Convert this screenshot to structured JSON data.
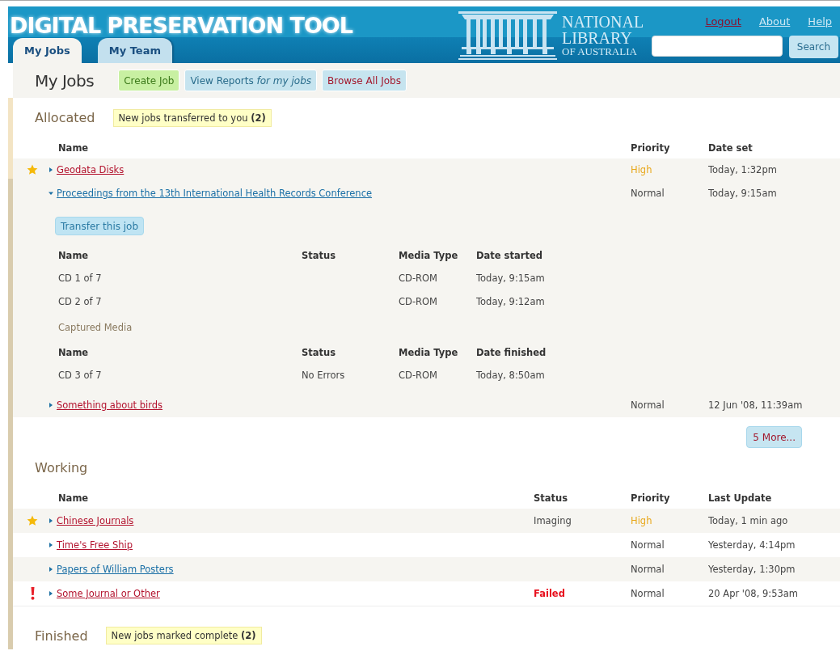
{
  "header": {
    "title": "DIGITAL PRESERVATION TOOL",
    "tabs": [
      {
        "label": "My Jobs",
        "selected": true
      },
      {
        "label": "My Team",
        "selected": false
      }
    ],
    "logo_lines": [
      "NATIONAL",
      "LIBRARY",
      "OF AUSTRALIA"
    ],
    "links": [
      {
        "label": "Logout",
        "kind": "logout"
      },
      {
        "label": "About",
        "kind": "plain"
      },
      {
        "label": "Help",
        "kind": "plain"
      }
    ],
    "search_button": "Search"
  },
  "toolbar": {
    "heading": "My Jobs",
    "buttons": [
      {
        "label": "Create Job",
        "kind": "create"
      },
      {
        "label": "View Reports *for my jobs*",
        "kind": "reports"
      },
      {
        "label": "Browse All Jobs",
        "kind": "browse"
      }
    ]
  },
  "sections": [
    {
      "title": "Allocated",
      "notice": "New jobs transferred to you **(2)**",
      "columns": [
        "Name",
        "Priority",
        "Date set"
      ],
      "rows": [
        {
          "starred": true,
          "alert": false,
          "name": "Geodata Disks",
          "visited": false,
          "expanded": false,
          "priority": "High",
          "high_priority": true,
          "date": "Today, 1:32pm"
        },
        {
          "starred": false,
          "alert": false,
          "name": "Proceedings from the 13th International Health Records Conference",
          "visited": true,
          "expanded": true,
          "priority": "Normal",
          "high_priority": false,
          "date": "Today, 9:15am",
          "detail": {
            "button": "Transfer this job",
            "tables": [
              {
                "columns": [
                  "Name",
                  "Status",
                  "Media Type",
                  "Date started"
                ],
                "rows": [
                  [
                    "CD 1 of 7",
                    "",
                    "CD-ROM",
                    "Today, 9:15am"
                  ],
                  [
                    "CD 2 of 7",
                    "",
                    "CD-ROM",
                    "Today, 9:12am"
                  ]
                ]
              },
              {
                "title": "Captured Media",
                "columns": [
                  "Name",
                  "Status",
                  "Media Type",
                  "Date finished"
                ],
                "rows": [
                  [
                    "CD 3 of 7",
                    "No Errors",
                    "CD-ROM",
                    "Today, 8:50am"
                  ]
                ]
              }
            ]
          }
        },
        {
          "starred": false,
          "alert": false,
          "name": "Something about birds",
          "visited": false,
          "expanded": false,
          "priority": "Normal",
          "high_priority": false,
          "date": "12 Jun '08, 11:39am"
        }
      ],
      "more_button": "5 More..."
    },
    {
      "title": "Working",
      "columns": [
        "Name",
        "Status",
        "Priority",
        "Last Update"
      ],
      "rows": [
        {
          "starred": true,
          "alert": false,
          "name": "Chinese Journals",
          "visited": false,
          "expanded": false,
          "status": "Imaging",
          "failed": false,
          "priority": "High",
          "high_priority": true,
          "date": "Today, 1 min ago"
        },
        {
          "starred": false,
          "alert": false,
          "name": "Time's Free Ship",
          "visited": false,
          "expanded": false,
          "priority": "Normal",
          "high_priority": false,
          "date": "Yesterday, 4:14pm"
        },
        {
          "starred": false,
          "alert": false,
          "name": "Papers of William Posters",
          "visited": true,
          "expanded": false,
          "priority": "Normal",
          "high_priority": false,
          "date": "Yesterday, 1:30pm"
        },
        {
          "starred": false,
          "alert": true,
          "name": "Some Journal or Other",
          "visited": false,
          "expanded": false,
          "status": "Failed",
          "failed": true,
          "priority": "Normal",
          "high_priority": false,
          "date": "20 Apr '08, 9:53am"
        }
      ]
    },
    {
      "title": "Finished",
      "notice": "New jobs marked complete **(2)**"
    }
  ]
}
